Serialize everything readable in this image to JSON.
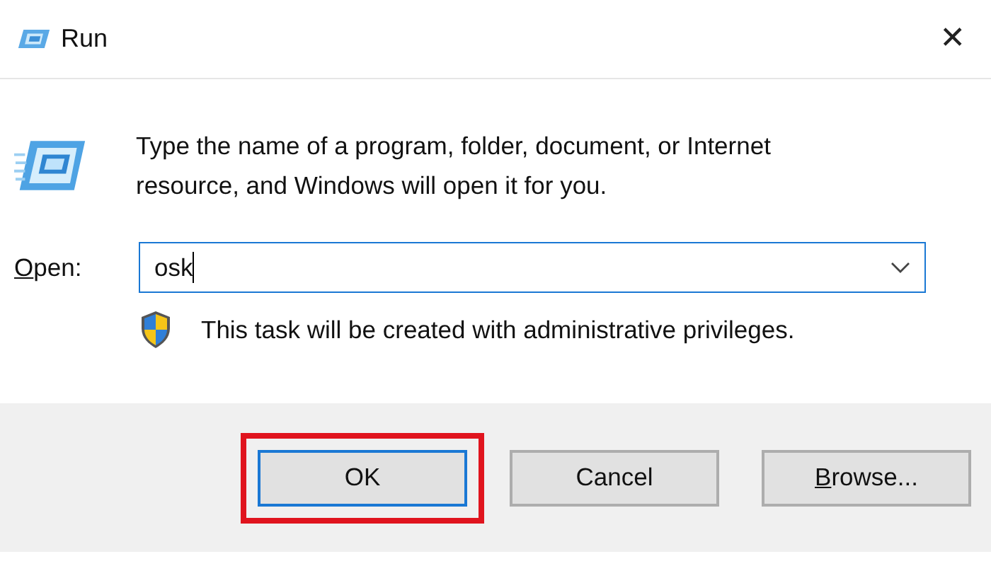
{
  "window": {
    "title": "Run",
    "close_symbol": "✕"
  },
  "description": "Type the name of a program, folder, document, or Internet resource, and Windows will open it for you.",
  "open_field": {
    "label_accel": "O",
    "label_rest": "pen:",
    "value": "osk"
  },
  "notice": "This task will be created with administrative privileges.",
  "buttons": [
    {
      "rest": "OK",
      "default": true,
      "highlighted": true
    },
    {
      "rest": "Cancel",
      "default": false,
      "highlighted": false
    },
    {
      "accel": "B",
      "rest": "rowse...",
      "default": false,
      "highlighted": false
    }
  ]
}
